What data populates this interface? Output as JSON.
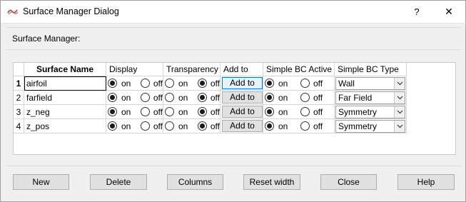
{
  "window": {
    "title": "Surface Manager Dialog",
    "help_glyph": "?",
    "close_glyph": "✕"
  },
  "section_label": "Surface Manager:",
  "table": {
    "headers": [
      "",
      "Surface Name",
      "Display",
      "Transparency",
      "Add to",
      "Simple BC Active",
      "Simple BC Type"
    ],
    "on_label": "on",
    "off_label": "off",
    "rows": [
      {
        "num": "1",
        "name": "airfoil",
        "display": "on",
        "transparency": "off",
        "add_label": "Add to",
        "bc_active": "on",
        "bc_type": "Wall"
      },
      {
        "num": "2",
        "name": "farfield",
        "display": "on",
        "transparency": "off",
        "add_label": "Add to",
        "bc_active": "on",
        "bc_type": "Far Field"
      },
      {
        "num": "3",
        "name": "z_neg",
        "display": "on",
        "transparency": "off",
        "add_label": "Add to",
        "bc_active": "on",
        "bc_type": "Symmetry"
      },
      {
        "num": "4",
        "name": "z_pos",
        "display": "on",
        "transparency": "off",
        "add_label": "Add to",
        "bc_active": "on",
        "bc_type": "Symmetry"
      }
    ]
  },
  "buttons": {
    "new": "New",
    "delete": "Delete",
    "columns": "Columns",
    "reset_width": "Reset width",
    "close": "Close",
    "help": "Help"
  }
}
